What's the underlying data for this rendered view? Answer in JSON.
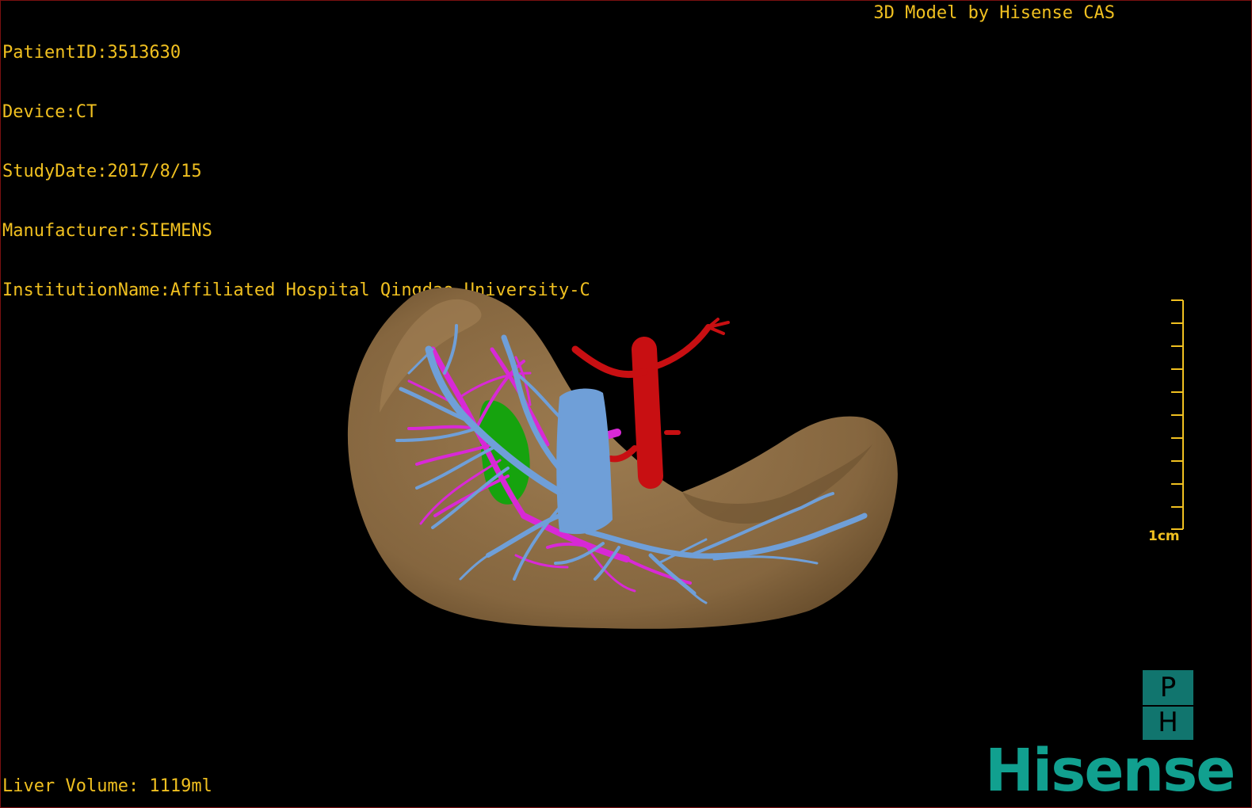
{
  "header": {
    "info_lines": [
      "PatientID:3513630",
      "Device:CT",
      "StudyDate:2017/8/15",
      "Manufacturer:SIEMENS",
      "InstitutionName:Affiliated Hospital Qingdao University-C"
    ],
    "credit": "3D Model by Hisense CAS"
  },
  "footer": {
    "volume": "Liver Volume: 1119ml"
  },
  "scale_bar": {
    "label": "1cm"
  },
  "logo": {
    "top_letter": "P",
    "bottom_letter": "H",
    "brand": "Hisense"
  },
  "model": {
    "structures": [
      {
        "name": "liver",
        "color": "#8f7047"
      },
      {
        "name": "portal-vein",
        "color": "#6f9fd8"
      },
      {
        "name": "hepatic-vein",
        "color": "#d829d6"
      },
      {
        "name": "hepatic-artery",
        "color": "#c80f12"
      },
      {
        "name": "gallbladder",
        "color": "#16a30e"
      }
    ]
  },
  "colors": {
    "overlay_text": "#f0c020",
    "brand": "#11a08f",
    "logo_box": "#11756e"
  }
}
